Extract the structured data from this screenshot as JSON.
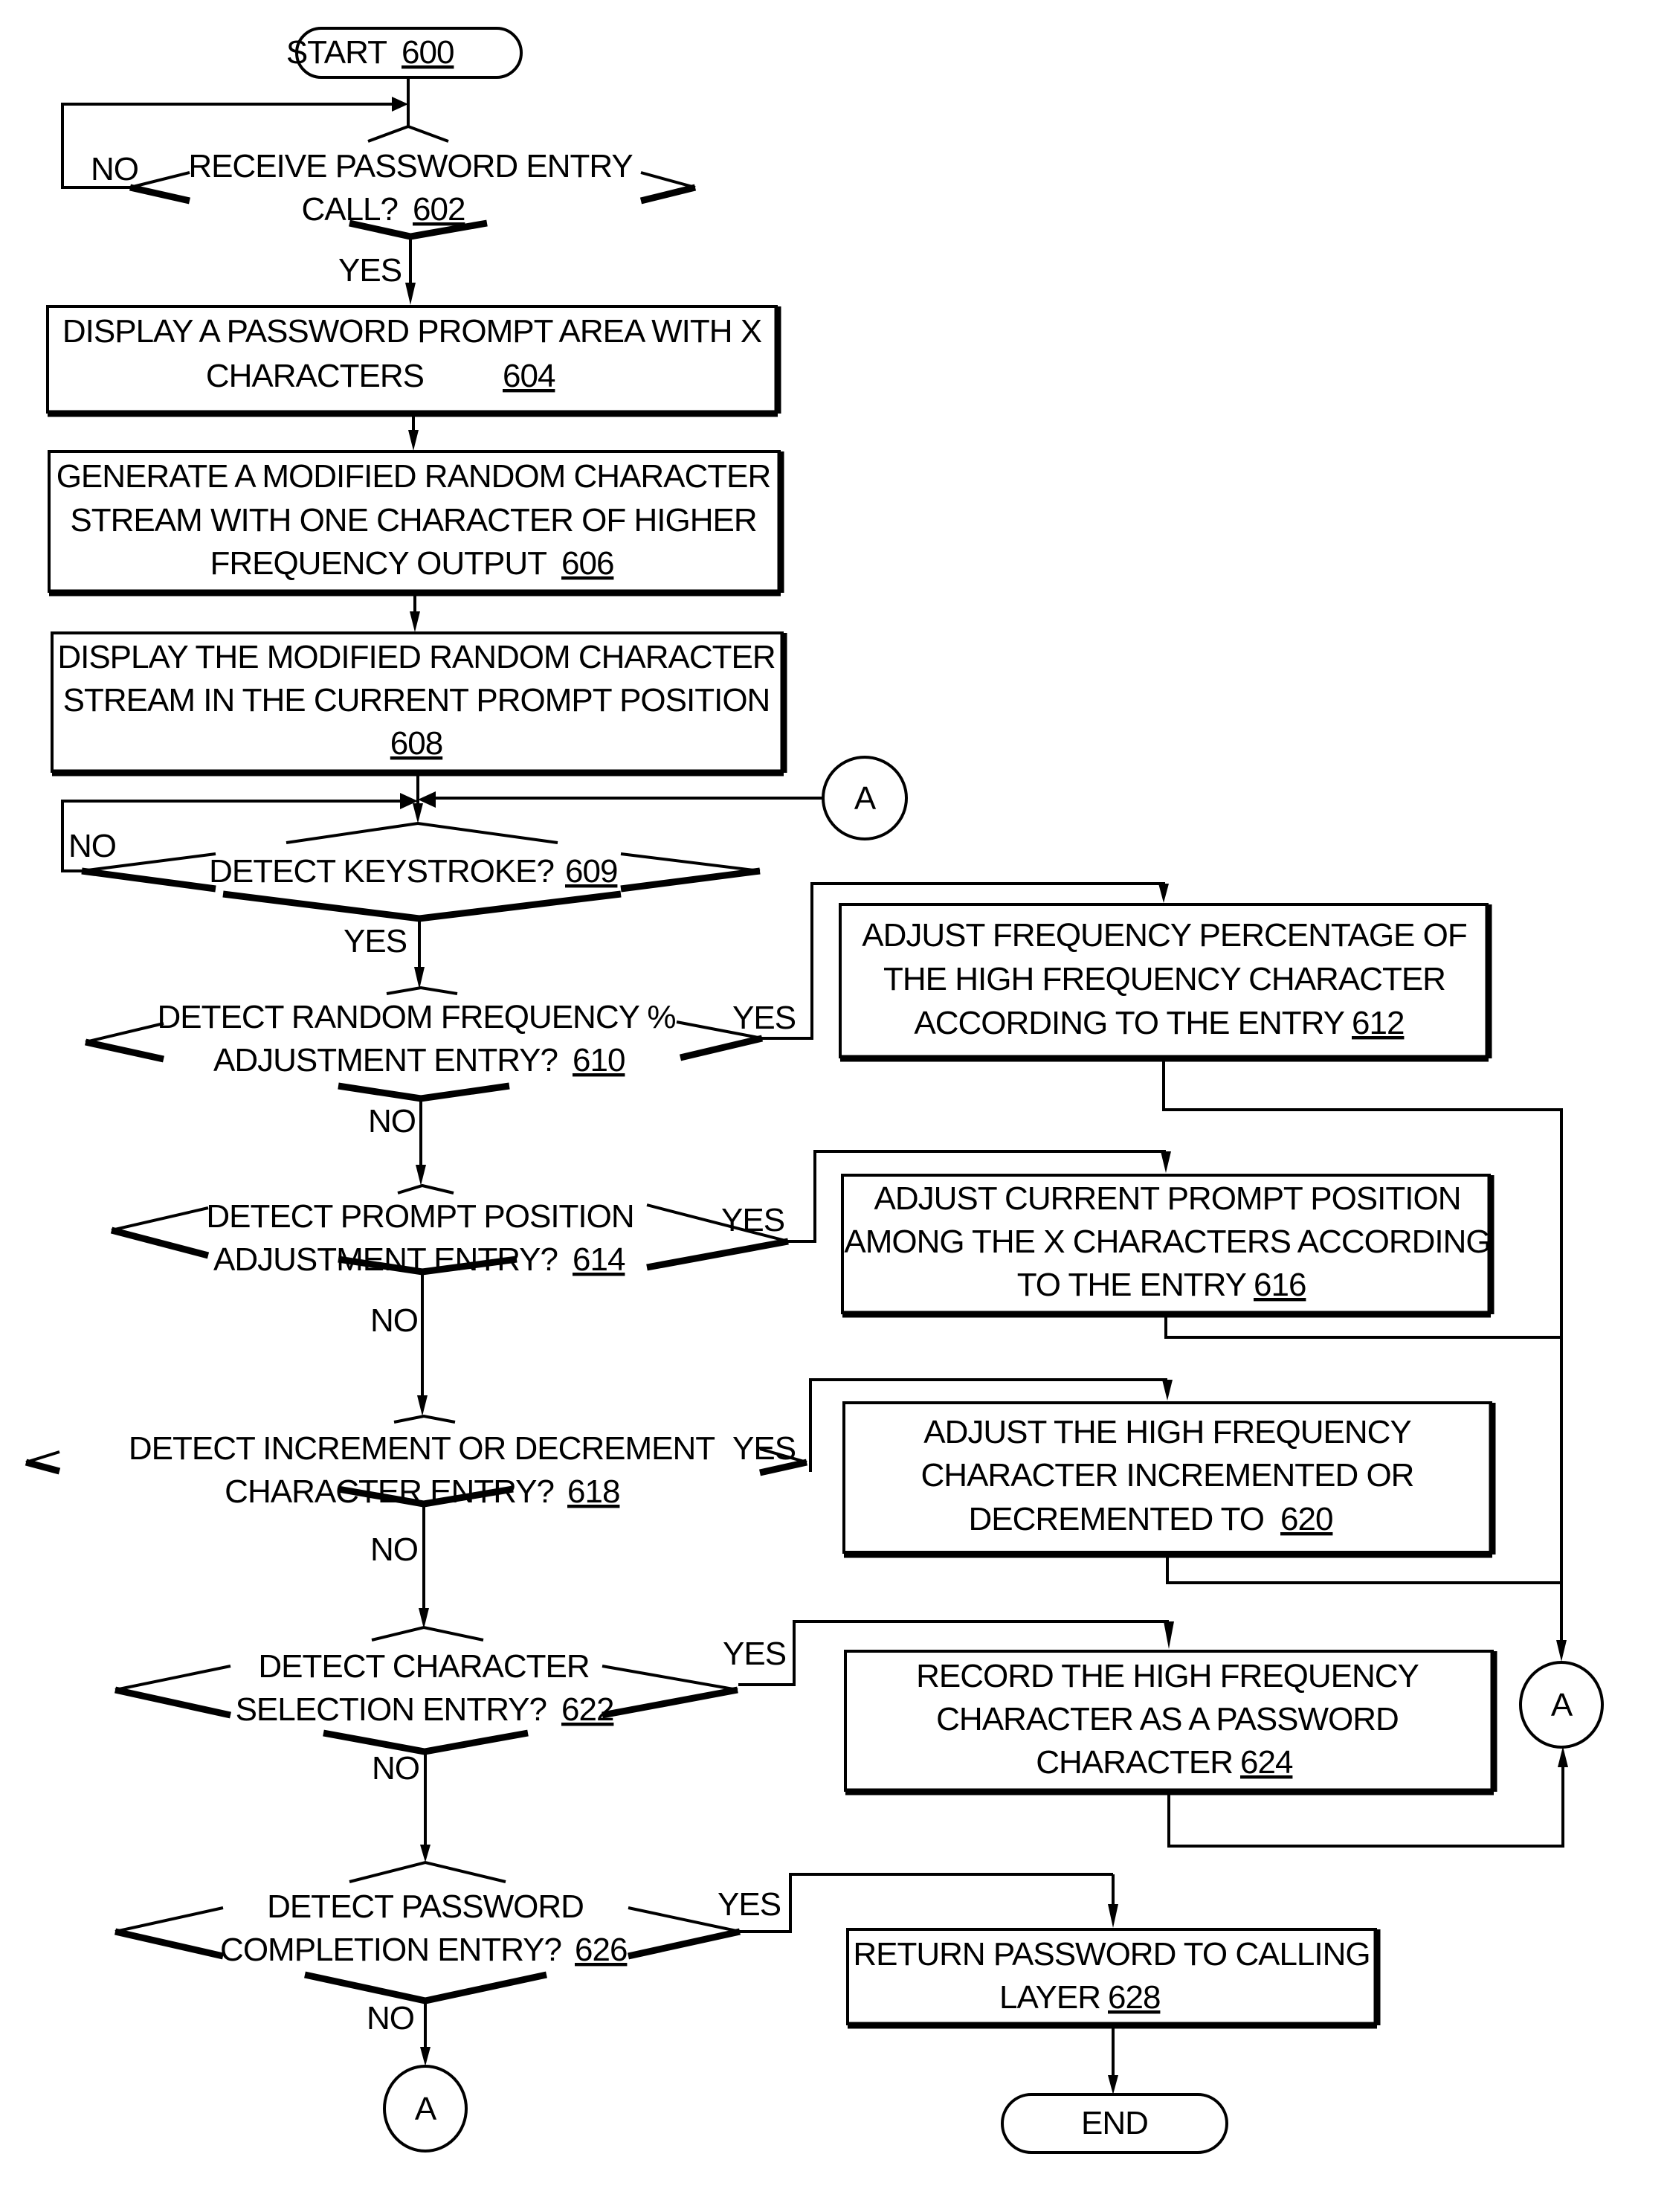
{
  "diagram": {
    "type": "flowchart",
    "nodes": {
      "start": {
        "text": "START",
        "ref": "600",
        "shape": "terminal"
      },
      "n602": {
        "lines": [
          "RECEIVE PASSWORD ENTRY",
          "CALL?"
        ],
        "ref": "602",
        "shape": "decision"
      },
      "n604": {
        "lines": [
          "DISPLAY A PASSWORD PROMPT AREA WITH X",
          "CHARACTERS"
        ],
        "ref": "604",
        "shape": "process"
      },
      "n606": {
        "lines": [
          "GENERATE A MODIFIED RANDOM CHARACTER",
          "STREAM WITH ONE CHARACTER OF HIGHER",
          "FREQUENCY OUTPUT"
        ],
        "ref": "606",
        "shape": "process"
      },
      "n608": {
        "lines": [
          "DISPLAY THE MODIFIED RANDOM CHARACTER",
          "STREAM IN THE CURRENT PROMPT POSITION",
          ""
        ],
        "ref": "608",
        "shape": "process"
      },
      "n609": {
        "lines": [
          "DETECT KEYSTROKE?"
        ],
        "ref": "609",
        "shape": "decision"
      },
      "n610": {
        "lines": [
          "DETECT RANDOM FREQUENCY %",
          "ADJUSTMENT ENTRY?"
        ],
        "ref": "610",
        "shape": "decision"
      },
      "n612": {
        "lines": [
          "ADJUST FREQUENCY PERCENTAGE OF",
          "THE HIGH FREQUENCY CHARACTER",
          "ACCORDING TO THE ENTRY"
        ],
        "ref": "612",
        "shape": "process"
      },
      "n614": {
        "lines": [
          "DETECT PROMPT POSITION",
          "ADJUSTMENT ENTRY?"
        ],
        "ref": "614",
        "shape": "decision"
      },
      "n616": {
        "lines": [
          "ADJUST CURRENT PROMPT POSITION",
          "AMONG THE X CHARACTERS ACCORDING",
          "TO THE ENTRY"
        ],
        "ref": "616",
        "shape": "process"
      },
      "n618": {
        "lines": [
          "DETECT INCREMENT OR DECREMENT",
          "CHARACTER ENTRY?"
        ],
        "ref": "618",
        "shape": "decision"
      },
      "n620": {
        "lines": [
          "ADJUST THE HIGH FREQUENCY",
          "CHARACTER INCREMENTED OR",
          "DECREMENTED TO"
        ],
        "ref": "620",
        "shape": "process"
      },
      "n622": {
        "lines": [
          "DETECT CHARACTER",
          "SELECTION ENTRY?"
        ],
        "ref": "622",
        "shape": "decision"
      },
      "n624": {
        "lines": [
          "RECORD THE HIGH FREQUENCY",
          "CHARACTER AS A PASSWORD",
          "CHARACTER"
        ],
        "ref": "624",
        "shape": "process"
      },
      "n626": {
        "lines": [
          "DETECT PASSWORD",
          "COMPLETION ENTRY?"
        ],
        "ref": "626",
        "shape": "decision"
      },
      "n628": {
        "lines": [
          "RETURN PASSWORD TO CALLING",
          "LAYER"
        ],
        "ref": "628",
        "shape": "process"
      },
      "end": {
        "text": "END",
        "shape": "terminal"
      },
      "connector": {
        "text": "A"
      }
    },
    "edge_labels": {
      "yes": "YES",
      "no": "NO"
    },
    "edges": [
      {
        "from": "start",
        "to": "n602"
      },
      {
        "from": "n602",
        "to": "n602",
        "label": "NO"
      },
      {
        "from": "n602",
        "to": "n604",
        "label": "YES"
      },
      {
        "from": "n604",
        "to": "n606"
      },
      {
        "from": "n606",
        "to": "n608"
      },
      {
        "from": "n608",
        "to": "n609"
      },
      {
        "from": "connector-A",
        "to": "n609"
      },
      {
        "from": "n609",
        "to": "n609",
        "label": "NO"
      },
      {
        "from": "n609",
        "to": "n610",
        "label": "YES"
      },
      {
        "from": "n610",
        "to": "n612",
        "label": "YES"
      },
      {
        "from": "n610",
        "to": "n614",
        "label": "NO"
      },
      {
        "from": "n614",
        "to": "n616",
        "label": "YES"
      },
      {
        "from": "n614",
        "to": "n618",
        "label": "NO"
      },
      {
        "from": "n618",
        "to": "n620",
        "label": "YES"
      },
      {
        "from": "n618",
        "to": "n622",
        "label": "NO"
      },
      {
        "from": "n622",
        "to": "n624",
        "label": "YES"
      },
      {
        "from": "n622",
        "to": "n626",
        "label": "NO"
      },
      {
        "from": "n612",
        "to": "connector-A"
      },
      {
        "from": "n616",
        "to": "connector-A"
      },
      {
        "from": "n620",
        "to": "connector-A"
      },
      {
        "from": "n624",
        "to": "connector-A"
      },
      {
        "from": "n626",
        "to": "n628",
        "label": "YES"
      },
      {
        "from": "n626",
        "to": "connector-A",
        "label": "NO"
      },
      {
        "from": "n628",
        "to": "end"
      }
    ]
  }
}
